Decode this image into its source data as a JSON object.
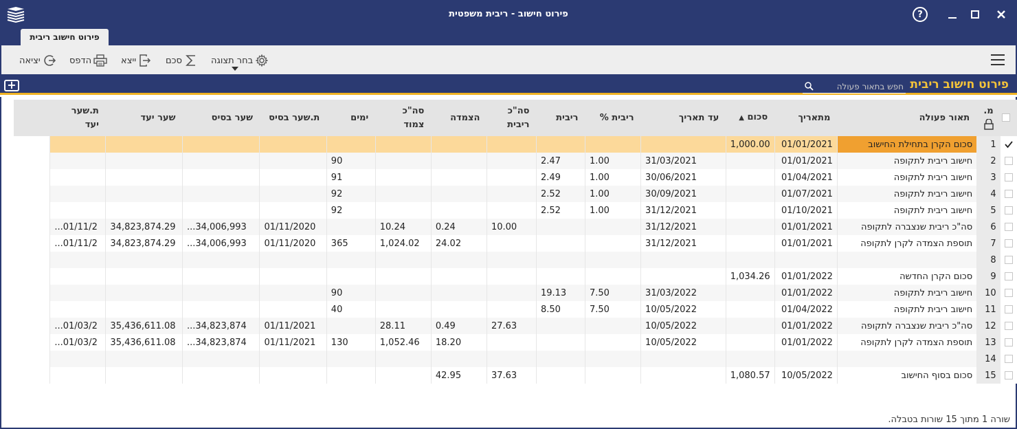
{
  "window": {
    "title": "פירוט חישוב - ריבית משפטית",
    "help_label": "?"
  },
  "tab": {
    "label": "פירוט חישוב ריבית"
  },
  "toolbar": {
    "choose_view": "בחר תצוגה",
    "sum": "סכם",
    "export": "ייצא",
    "print": "הדפס",
    "exit": "יציאה"
  },
  "section": {
    "title": "פירוט חישוב ריבית",
    "search_placeholder": "חפש בתאור פעולה"
  },
  "table": {
    "columns": {
      "no": "מ.",
      "desc": "תאור פעולה",
      "from_date": "מתאריך",
      "amount": "סכום",
      "to_date": "עד תאריך",
      "rate_pct": "ריבית %",
      "interest": "ריבית",
      "total_interest": "סה\"כ ריבית",
      "linkage": "הצמדה",
      "total_linked": "סה\"כ צמוד",
      "days": "ימים",
      "base_rate_date": "ת.שער בסיס",
      "base_rate": "שער בסיס",
      "target_rate": "שער יעד",
      "target_rate_date": "ת.שער יעד"
    },
    "rows": [
      {
        "no": "1",
        "desc": "סכום הקרן בתחילת החישוב",
        "from_date": "01/01/2021",
        "amount": "1,000.00",
        "to_date": "",
        "rate_pct": "",
        "interest": "",
        "total_interest": "",
        "linkage": "",
        "total_linked": "",
        "days": "",
        "base_rate_date": "",
        "base_rate": "",
        "target_rate": "",
        "target_rate_date": ""
      },
      {
        "no": "2",
        "desc": "חישוב ריבית לתקופה",
        "from_date": "01/01/2021",
        "amount": "",
        "to_date": "31/03/2021",
        "rate_pct": "1.00",
        "interest": "2.47",
        "total_interest": "",
        "linkage": "",
        "total_linked": "",
        "days": "90",
        "base_rate_date": "",
        "base_rate": "",
        "target_rate": "",
        "target_rate_date": ""
      },
      {
        "no": "3",
        "desc": "חישוב ריבית לתקופה",
        "from_date": "01/04/2021",
        "amount": "",
        "to_date": "30/06/2021",
        "rate_pct": "1.00",
        "interest": "2.49",
        "total_interest": "",
        "linkage": "",
        "total_linked": "",
        "days": "91",
        "base_rate_date": "",
        "base_rate": "",
        "target_rate": "",
        "target_rate_date": ""
      },
      {
        "no": "4",
        "desc": "חישוב ריבית לתקופה",
        "from_date": "01/07/2021",
        "amount": "",
        "to_date": "30/09/2021",
        "rate_pct": "1.00",
        "interest": "2.52",
        "total_interest": "",
        "linkage": "",
        "total_linked": "",
        "days": "92",
        "base_rate_date": "",
        "base_rate": "",
        "target_rate": "",
        "target_rate_date": ""
      },
      {
        "no": "5",
        "desc": "חישוב ריבית לתקופה",
        "from_date": "01/10/2021",
        "amount": "",
        "to_date": "31/12/2021",
        "rate_pct": "1.00",
        "interest": "2.52",
        "total_interest": "",
        "linkage": "",
        "total_linked": "",
        "days": "92",
        "base_rate_date": "",
        "base_rate": "",
        "target_rate": "",
        "target_rate_date": ""
      },
      {
        "no": "6",
        "desc": "סה\"כ ריבית שנצברה לתקופה",
        "from_date": "01/01/2021",
        "amount": "",
        "to_date": "31/12/2021",
        "rate_pct": "",
        "interest": "",
        "total_interest": "10.00",
        "linkage": "0.24",
        "total_linked": "10.24",
        "days": "",
        "base_rate_date": "01/11/2020",
        "base_rate": "34,006,993...",
        "target_rate": "34,823,874.29",
        "target_rate_date": "01/11/2..."
      },
      {
        "no": "7",
        "desc": "תוספת הצמדה לקרן לתקופה",
        "from_date": "01/01/2021",
        "amount": "",
        "to_date": "31/12/2021",
        "rate_pct": "",
        "interest": "",
        "total_interest": "",
        "linkage": "24.02",
        "total_linked": "1,024.02",
        "days": "365",
        "base_rate_date": "01/11/2020",
        "base_rate": "34,006,993...",
        "target_rate": "34,823,874.29",
        "target_rate_date": "01/11/2..."
      },
      {
        "no": "8",
        "desc": "",
        "from_date": "",
        "amount": "",
        "to_date": "",
        "rate_pct": "",
        "interest": "",
        "total_interest": "",
        "linkage": "",
        "total_linked": "",
        "days": "",
        "base_rate_date": "",
        "base_rate": "",
        "target_rate": "",
        "target_rate_date": ""
      },
      {
        "no": "9",
        "desc": "סכום הקרן החדשה",
        "from_date": "01/01/2022",
        "amount": "1,034.26",
        "to_date": "",
        "rate_pct": "",
        "interest": "",
        "total_interest": "",
        "linkage": "",
        "total_linked": "",
        "days": "",
        "base_rate_date": "",
        "base_rate": "",
        "target_rate": "",
        "target_rate_date": ""
      },
      {
        "no": "10",
        "desc": "חישוב ריבית לתקופה",
        "from_date": "01/01/2022",
        "amount": "",
        "to_date": "31/03/2022",
        "rate_pct": "7.50",
        "interest": "19.13",
        "total_interest": "",
        "linkage": "",
        "total_linked": "",
        "days": "90",
        "base_rate_date": "",
        "base_rate": "",
        "target_rate": "",
        "target_rate_date": ""
      },
      {
        "no": "11",
        "desc": "חישוב ריבית לתקופה",
        "from_date": "01/04/2022",
        "amount": "",
        "to_date": "10/05/2022",
        "rate_pct": "7.50",
        "interest": "8.50",
        "total_interest": "",
        "linkage": "",
        "total_linked": "",
        "days": "40",
        "base_rate_date": "",
        "base_rate": "",
        "target_rate": "",
        "target_rate_date": ""
      },
      {
        "no": "12",
        "desc": "סה\"כ ריבית שנצברה לתקופה",
        "from_date": "01/01/2022",
        "amount": "",
        "to_date": "10/05/2022",
        "rate_pct": "",
        "interest": "",
        "total_interest": "27.63",
        "linkage": "0.49",
        "total_linked": "28.11",
        "days": "",
        "base_rate_date": "01/11/2021",
        "base_rate": "34,823,874...",
        "target_rate": "35,436,611.08",
        "target_rate_date": "01/03/2..."
      },
      {
        "no": "13",
        "desc": "תוספת הצמדה לקרן לתקופה",
        "from_date": "01/01/2022",
        "amount": "",
        "to_date": "10/05/2022",
        "rate_pct": "",
        "interest": "",
        "total_interest": "",
        "linkage": "18.20",
        "total_linked": "1,052.46",
        "days": "130",
        "base_rate_date": "01/11/2021",
        "base_rate": "34,823,874...",
        "target_rate": "35,436,611.08",
        "target_rate_date": "01/03/2..."
      },
      {
        "no": "14",
        "desc": "",
        "from_date": "",
        "amount": "",
        "to_date": "",
        "rate_pct": "",
        "interest": "",
        "total_interest": "",
        "linkage": "",
        "total_linked": "",
        "days": "",
        "base_rate_date": "",
        "base_rate": "",
        "target_rate": "",
        "target_rate_date": ""
      },
      {
        "no": "15",
        "desc": "סכום בסוף החישוב",
        "from_date": "10/05/2022",
        "amount": "1,080.57",
        "to_date": "",
        "rate_pct": "",
        "interest": "",
        "total_interest": "37.63",
        "linkage": "42.95",
        "total_linked": "",
        "days": "",
        "base_rate_date": "",
        "base_rate": "",
        "target_rate": "",
        "target_rate_date": ""
      }
    ],
    "selected_row": 0
  },
  "status": {
    "text": "שורה 1 מתוך 15 שורות בטבלה."
  },
  "colors": {
    "navy": "#2b3a72",
    "accent": "#f0b323",
    "selected_row": "#fcd99a",
    "selected_cell": "#f0a030"
  }
}
